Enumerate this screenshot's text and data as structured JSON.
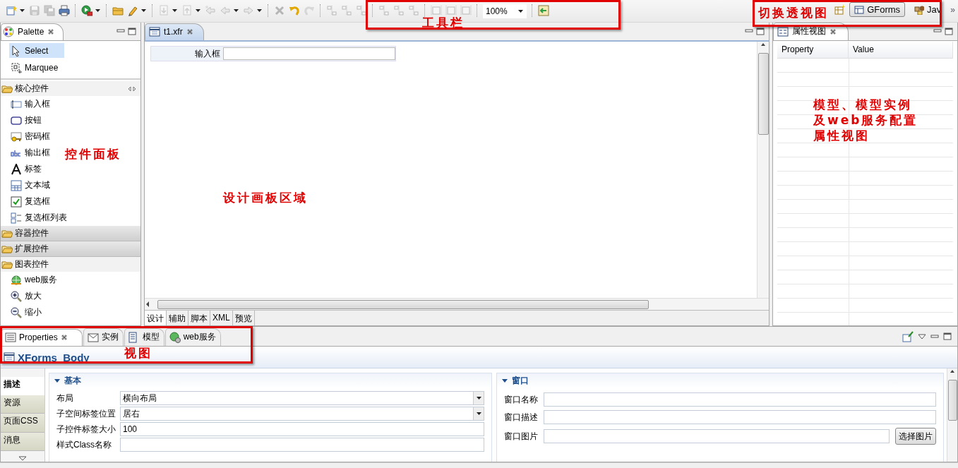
{
  "toolbar": {
    "items": [
      {
        "kind": "new-file",
        "disabled": false,
        "dropdown": true
      },
      {
        "kind": "save",
        "disabled": true,
        "dropdown": false
      },
      {
        "kind": "save-all",
        "disabled": true,
        "dropdown": false
      },
      {
        "kind": "print",
        "disabled": false,
        "dropdown": false
      },
      {
        "kind": "separator"
      },
      {
        "kind": "run",
        "disabled": false,
        "dropdown": true
      },
      {
        "kind": "separator"
      },
      {
        "kind": "folder",
        "disabled": false,
        "dropdown": false
      },
      {
        "kind": "pen",
        "disabled": false,
        "dropdown": true
      },
      {
        "kind": "separator"
      },
      {
        "kind": "import",
        "disabled": true,
        "dropdown": true
      },
      {
        "kind": "export",
        "disabled": true,
        "dropdown": true
      },
      {
        "kind": "back-edit",
        "disabled": true,
        "dropdown": false
      },
      {
        "kind": "back",
        "disabled": true,
        "dropdown": true
      },
      {
        "kind": "forward",
        "disabled": true,
        "dropdown": true
      },
      {
        "kind": "separator"
      },
      {
        "kind": "delete",
        "disabled": true,
        "dropdown": false
      },
      {
        "kind": "undo",
        "disabled": false,
        "dropdown": false
      },
      {
        "kind": "redo",
        "disabled": true,
        "dropdown": false
      },
      {
        "kind": "separator"
      },
      {
        "kind": "align",
        "disabled": true,
        "dropdown": false
      },
      {
        "kind": "align",
        "disabled": true,
        "dropdown": false
      },
      {
        "kind": "align",
        "disabled": true,
        "dropdown": false
      },
      {
        "kind": "separator"
      },
      {
        "kind": "align",
        "disabled": true,
        "dropdown": false
      },
      {
        "kind": "align",
        "disabled": true,
        "dropdown": false
      },
      {
        "kind": "align",
        "disabled": true,
        "dropdown": false
      },
      {
        "kind": "separator"
      },
      {
        "kind": "size",
        "disabled": true,
        "dropdown": false
      },
      {
        "kind": "size",
        "disabled": true,
        "dropdown": false
      },
      {
        "kind": "size",
        "disabled": true,
        "dropdown": false
      },
      {
        "kind": "separator"
      },
      {
        "kind": "zoom-combo",
        "value": "100%"
      },
      {
        "kind": "separator"
      },
      {
        "kind": "preview",
        "disabled": false,
        "dropdown": false
      }
    ],
    "annotation": "工具栏",
    "perspectives": {
      "annotation": "切换透视图",
      "items": [
        {
          "label": "GForms",
          "selected": true
        },
        {
          "label": "Jav",
          "selected": false
        }
      ],
      "overflow": "»"
    }
  },
  "palette": {
    "title": "Palette",
    "tools": [
      {
        "label": "Select",
        "selected": true
      },
      {
        "label": "Marquee",
        "selected": false
      }
    ],
    "drawers": [
      {
        "label": "核心控件",
        "expanded": true,
        "items": [
          {
            "kind": "input",
            "label": "输入框"
          },
          {
            "kind": "button",
            "label": "按钮"
          },
          {
            "kind": "password",
            "label": "密码框"
          },
          {
            "kind": "output",
            "label": "输出框"
          },
          {
            "kind": "label",
            "label": "标签"
          },
          {
            "kind": "textarea",
            "label": "文本域"
          },
          {
            "kind": "checkbox",
            "label": "复选框"
          },
          {
            "kind": "checkbox-list",
            "label": "复选框列表"
          }
        ]
      },
      {
        "label": "容器控件",
        "expanded": false
      },
      {
        "label": "扩展控件",
        "expanded": false
      },
      {
        "label": "图表控件",
        "expanded": true,
        "items": [
          {
            "kind": "web-service",
            "label": "web服务"
          },
          {
            "kind": "zoom-in",
            "label": "放大"
          },
          {
            "kind": "zoom-out",
            "label": "缩小"
          }
        ]
      }
    ],
    "annotation": "控件面板"
  },
  "editor": {
    "tab": {
      "label": "t1.xfr",
      "selected": true
    },
    "fields": [
      {
        "label": "输入框"
      }
    ],
    "annotation": "设计画板区域",
    "bottom_tabs": [
      {
        "label": "设计",
        "selected": true
      },
      {
        "label": "辅助",
        "selected": false
      },
      {
        "label": "脚本",
        "selected": false
      },
      {
        "label": "XML",
        "selected": false
      },
      {
        "label": "预览",
        "selected": false
      }
    ]
  },
  "property_view": {
    "tab": "属性视图",
    "columns": [
      "Property",
      "Value"
    ],
    "annotation": [
      "模型、模型实例",
      "及web服务配置",
      "属性视图"
    ]
  },
  "bottom_panel": {
    "tabs": [
      {
        "kind": "properties",
        "label": "Properties",
        "selected": true
      },
      {
        "kind": "instance",
        "label": "实例",
        "selected": false
      },
      {
        "kind": "model",
        "label": "模型",
        "selected": false
      },
      {
        "kind": "web-service",
        "label": "web服务",
        "selected": false
      }
    ],
    "annotation": "视图",
    "title": "XForms_Body",
    "side_tabs": [
      {
        "label": "描述",
        "selected": true
      },
      {
        "label": "资源",
        "selected": false
      },
      {
        "label": "页面CSS",
        "selected": false
      },
      {
        "label": "消息",
        "selected": false
      }
    ],
    "sections": [
      {
        "title": "基本",
        "expanded": true,
        "fields": [
          {
            "kind": "combo",
            "label": "布局",
            "value": "横向布局"
          },
          {
            "kind": "combo",
            "label": "子空间标签位置",
            "value": "居右"
          },
          {
            "kind": "text",
            "label": "子控件标签大小",
            "value": "100"
          },
          {
            "kind": "text",
            "label": "样式Class名称"
          }
        ]
      },
      {
        "title": "窗口",
        "expanded": true,
        "fields": [
          {
            "kind": "text",
            "label": "窗口名称"
          },
          {
            "kind": "text",
            "label": "窗口描述"
          },
          {
            "kind": "file",
            "label": "窗口图片",
            "button": "选择图片"
          }
        ]
      }
    ]
  }
}
